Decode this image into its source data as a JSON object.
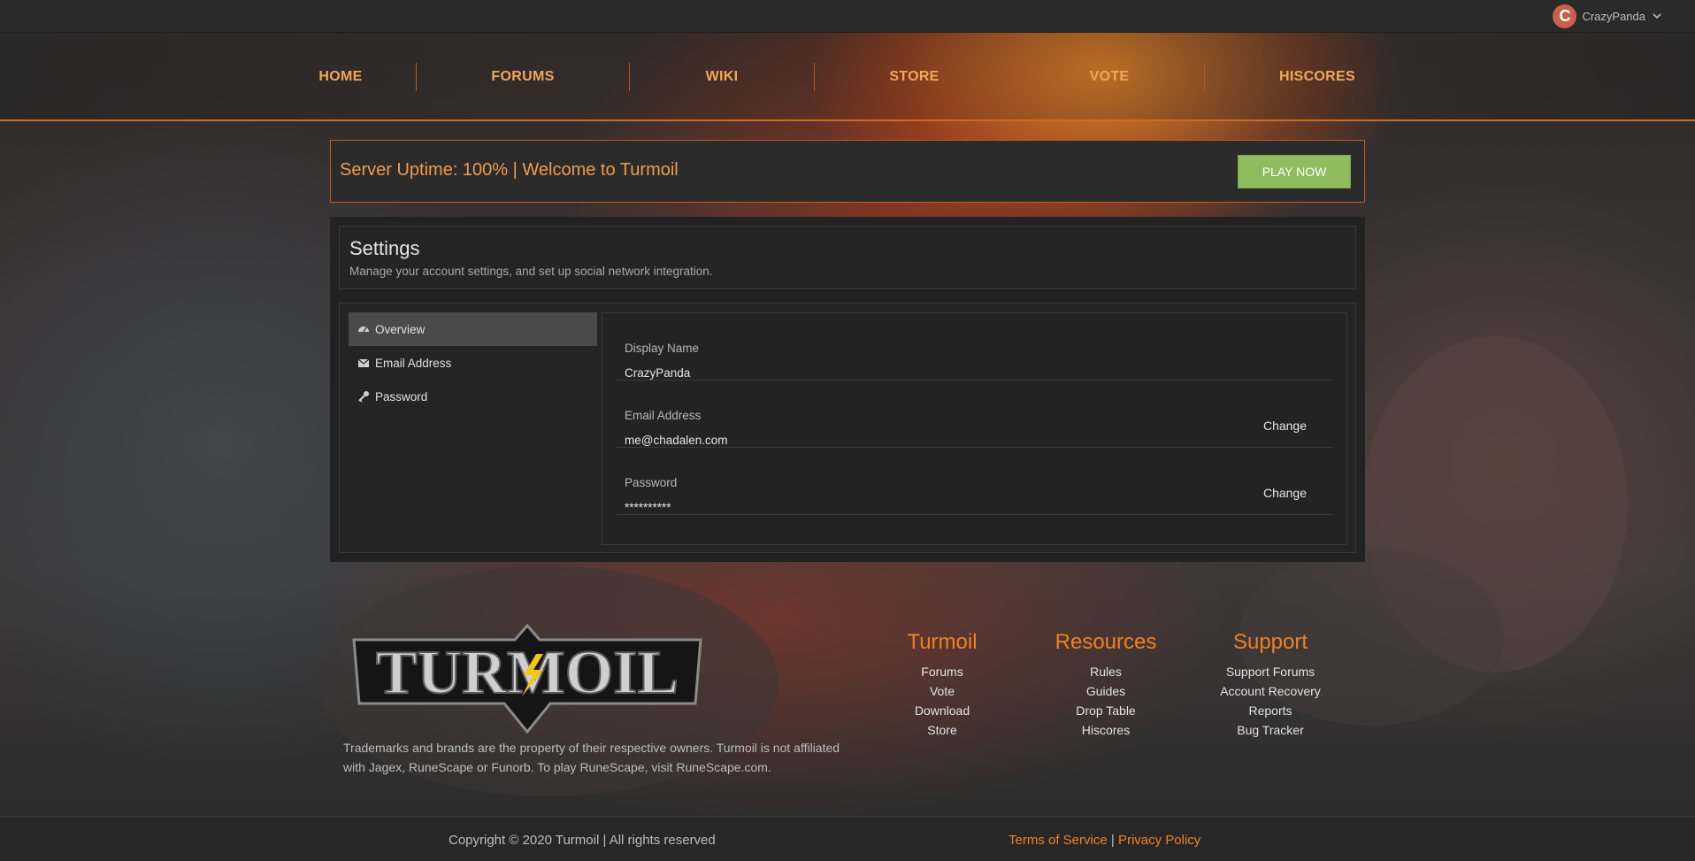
{
  "user": {
    "avatar_initial": "C",
    "name": "CrazyPanda"
  },
  "nav": {
    "items": [
      {
        "label": "HOME"
      },
      {
        "label": "FORUMS"
      },
      {
        "label": "WIKI"
      },
      {
        "label": "STORE"
      },
      {
        "label": "VOTE"
      },
      {
        "label": "HISCORES"
      }
    ]
  },
  "banner": {
    "text": "Server Uptime: 100% | Welcome to Turmoil",
    "play_label": "PLAY NOW"
  },
  "settings": {
    "title": "Settings",
    "subtitle": "Manage your account settings, and set up social network integration.",
    "sidebar": [
      {
        "label": "Overview",
        "icon": "dashboard-icon"
      },
      {
        "label": "Email Address",
        "icon": "envelope-icon"
      },
      {
        "label": "Password",
        "icon": "key-icon"
      }
    ],
    "rows": [
      {
        "label": "Display Name",
        "value": "CrazyPanda",
        "action": ""
      },
      {
        "label": "Email Address",
        "value": "me@chadalen.com",
        "action": "Change"
      },
      {
        "label": "Password",
        "value": "**********",
        "action": "Change"
      }
    ]
  },
  "footer": {
    "logo_text": "TURMOIL",
    "disclaimer": "Trademarks and brands are the property of their respective owners. Turmoil is not affiliated with Jagex, RuneScape or Funorb. To play RuneScape, visit RuneScape.com.",
    "columns": [
      {
        "title": "Turmoil",
        "links": [
          "Forums",
          "Vote",
          "Download",
          "Store"
        ]
      },
      {
        "title": "Resources",
        "links": [
          "Rules",
          "Guides",
          "Drop Table",
          "Hiscores"
        ]
      },
      {
        "title": "Support",
        "links": [
          "Support Forums",
          "Account Recovery",
          "Reports",
          "Bug Tracker"
        ]
      }
    ],
    "copyright": "Copyright © 2020 Turmoil | All rights reserved",
    "terms": "Terms of Service",
    "legal_sep": "|",
    "privacy": "Privacy Policy"
  },
  "colors": {
    "accent": "#f0811f",
    "nav_text": "#f1a75a",
    "play_button": "#8fbc5c",
    "avatar": "#c8614a"
  }
}
